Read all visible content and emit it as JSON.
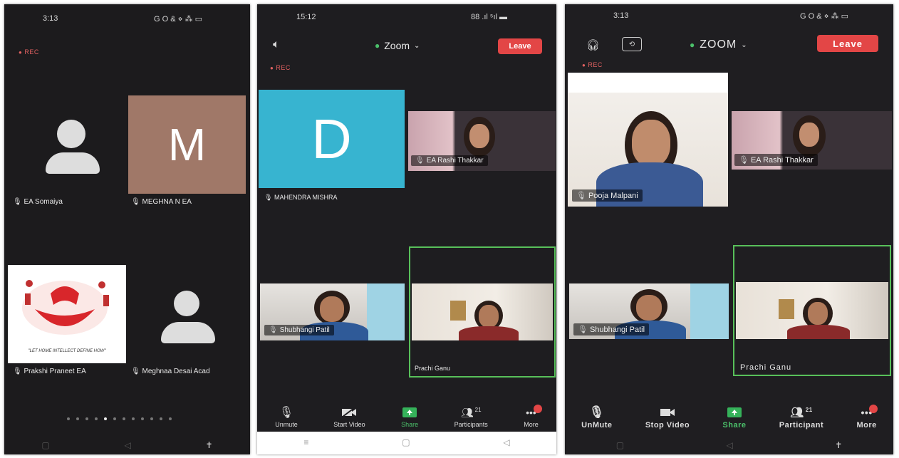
{
  "p1": {
    "time": "3:13",
    "status_icons": "G O & ⋄ ⁂ ▭",
    "rec": "REC",
    "tiles": [
      {
        "name": "EA Somaiya"
      },
      {
        "letter": "M",
        "name": "MEGHNA N EA"
      },
      {
        "name": "Prakshi Praneet EA",
        "logo_caption": "\"LET HOME INTELLECT DEFINE HOW\""
      },
      {
        "name": "Meghnaa Desai Acad"
      }
    ],
    "nav": [
      "▢",
      "◁",
      "✝"
    ]
  },
  "p2": {
    "time": "15:12",
    "status_icons": "88 .ıl ⁵ıl ▬",
    "rec": "REC",
    "meeting_title": "Zoom",
    "leave_label": "Leave",
    "tiles": [
      {
        "letter": "D",
        "name": "MAHENDRA MISHRA"
      },
      {
        "name": "EA Rashi Thakkar"
      },
      {
        "name": "Shubhangi Patil"
      },
      {
        "name": "Prachi Ganu"
      }
    ],
    "toolbar": [
      {
        "label": "Unmute",
        "icon": "mic-off-icon"
      },
      {
        "label": "Start Video",
        "icon": "video-off-icon"
      },
      {
        "label": "Share",
        "icon": "share-icon"
      },
      {
        "label": "Participants",
        "icon": "participants-icon",
        "count": "21"
      },
      {
        "label": "More",
        "icon": "more-icon"
      }
    ],
    "nav": [
      "≡",
      "▢",
      "◁"
    ]
  },
  "p3": {
    "time": "3:13",
    "status_icons": "G O & ⋄ ⁂ ▭",
    "rec": "REC",
    "meeting_title": "ZOOM",
    "leave_label": "Leave",
    "tiles": [
      {
        "name": "Pooja Malpani"
      },
      {
        "name": "EA Rashi Thakkar"
      },
      {
        "name": "Shubhangi Patil"
      },
      {
        "name": "Prachi Ganu"
      }
    ],
    "toolbar": [
      {
        "label": "UnMute",
        "icon": "mic-off-icon"
      },
      {
        "label": "Stop Video",
        "icon": "video-icon"
      },
      {
        "label": "Share",
        "icon": "share-icon"
      },
      {
        "label": "Participant",
        "icon": "participants-icon",
        "count": "21"
      },
      {
        "label": "More",
        "icon": "more-icon"
      }
    ],
    "nav": [
      "▢",
      "◁",
      "✝"
    ]
  },
  "colors": {
    "accent_green": "#58c05a",
    "leave_red": "#e34646",
    "avatar_m": "#a07868",
    "avatar_d": "#37b4d0"
  }
}
